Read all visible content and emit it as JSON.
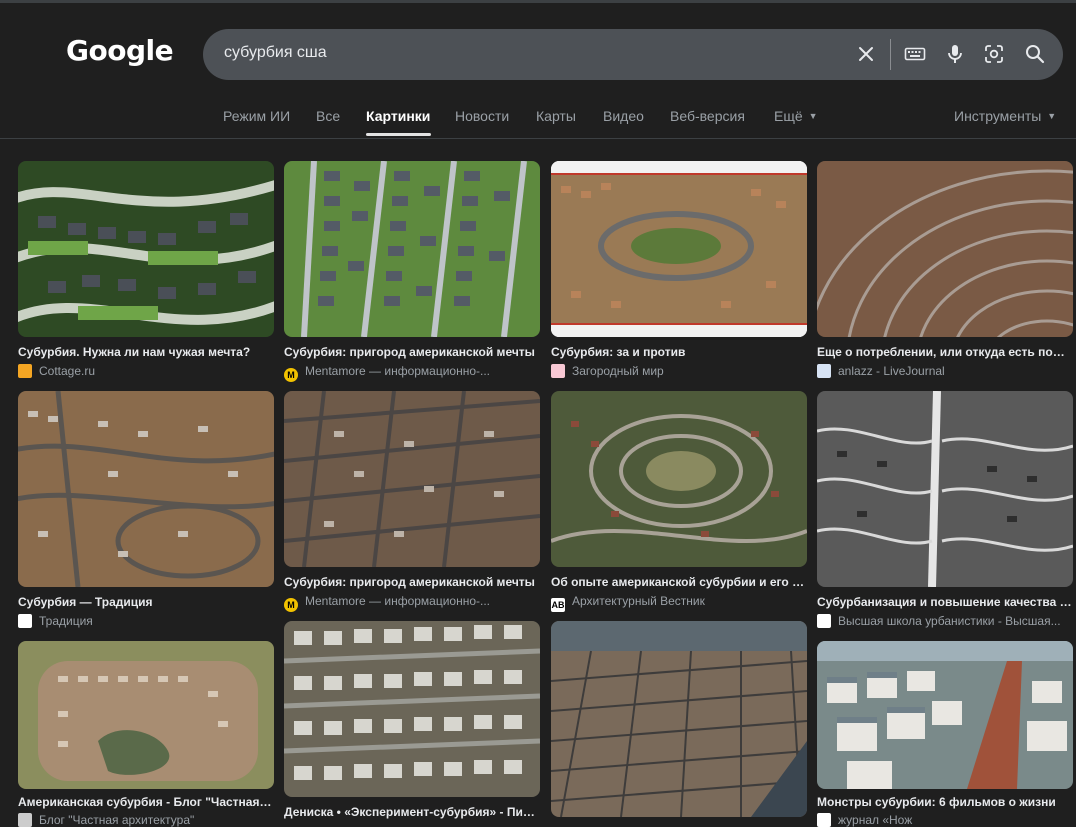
{
  "header": {
    "logo": "Google",
    "query": "субурбия сша"
  },
  "tabs": [
    {
      "label": "Режим ИИ"
    },
    {
      "label": "Все"
    },
    {
      "label": "Картинки"
    },
    {
      "label": "Новости"
    },
    {
      "label": "Карты"
    },
    {
      "label": "Видео"
    },
    {
      "label": "Веб-версия"
    },
    {
      "label": "Ещё"
    },
    {
      "label": "Инструменты"
    }
  ],
  "results": [
    {
      "title": "Субурбия. Нужна ли нам чужая мечта?",
      "source": "Cottage.ru",
      "favicon": "cottage-favicon",
      "fav_color": "#f5a623"
    },
    {
      "title": "Субурбия: пригород американской мечты",
      "source": "Mentamore — информационно-...",
      "favicon": "mentamore-favicon",
      "fav_color": "#f2c200"
    },
    {
      "title": "Субурбия: за и против",
      "source": "Загородный мир",
      "favicon": "zagorodny-favicon",
      "fav_color": "#f8c8d4"
    },
    {
      "title": "Еще о потреблении, или откуда есть пошла",
      "source": "anlazz - LiveJournal",
      "favicon": "livejournal-favicon",
      "fav_color": "#d7e3f4"
    },
    {
      "title": "Субурбия — Традиция",
      "source": "Традиция",
      "favicon": "tradition-favicon",
      "fav_color": "#ffffff"
    },
    {
      "title": "Субурбия: пригород американской мечты",
      "source": "Mentamore — информационно-...",
      "favicon": "mentamore-favicon",
      "fav_color": "#f2c200"
    },
    {
      "title": "Об опыте американской субурбии и его последствиях",
      "source": "Архитектурный Вестник",
      "favicon": "ab-favicon",
      "fav_color": "#ffffff",
      "fav_text": "AB"
    },
    {
      "title": "Субурбанизация и повышение качества жизни",
      "source": "Высшая школа урбанистики - Высшая...",
      "favicon": "hse-favicon",
      "fav_color": "#ffffff"
    },
    {
      "title": "Американская субурбия - Блог \"Частная архитектура\"",
      "source": "Блог \"Частная архитектура\"",
      "favicon": "blog-favicon",
      "fav_color": "#cccccc"
    },
    {
      "title": "Дениска • «Эксперимент-субурбия» - Пикабу",
      "source": "",
      "favicon": "pikabu-favicon",
      "fav_color": "#cccccc"
    },
    {
      "title": "",
      "source": "",
      "favicon": "",
      "fav_color": "#cccccc"
    },
    {
      "title": "Монстры субурбии: 6 фильмов о жизни",
      "source": "журнал «Нож",
      "favicon": "knife-favicon",
      "fav_color": "#ffffff"
    }
  ],
  "colors": {
    "background": "#1f1f1f",
    "search_box": "#4d5156",
    "active_tab": "#ffffff",
    "inactive_tab": "#9aa0a6"
  }
}
